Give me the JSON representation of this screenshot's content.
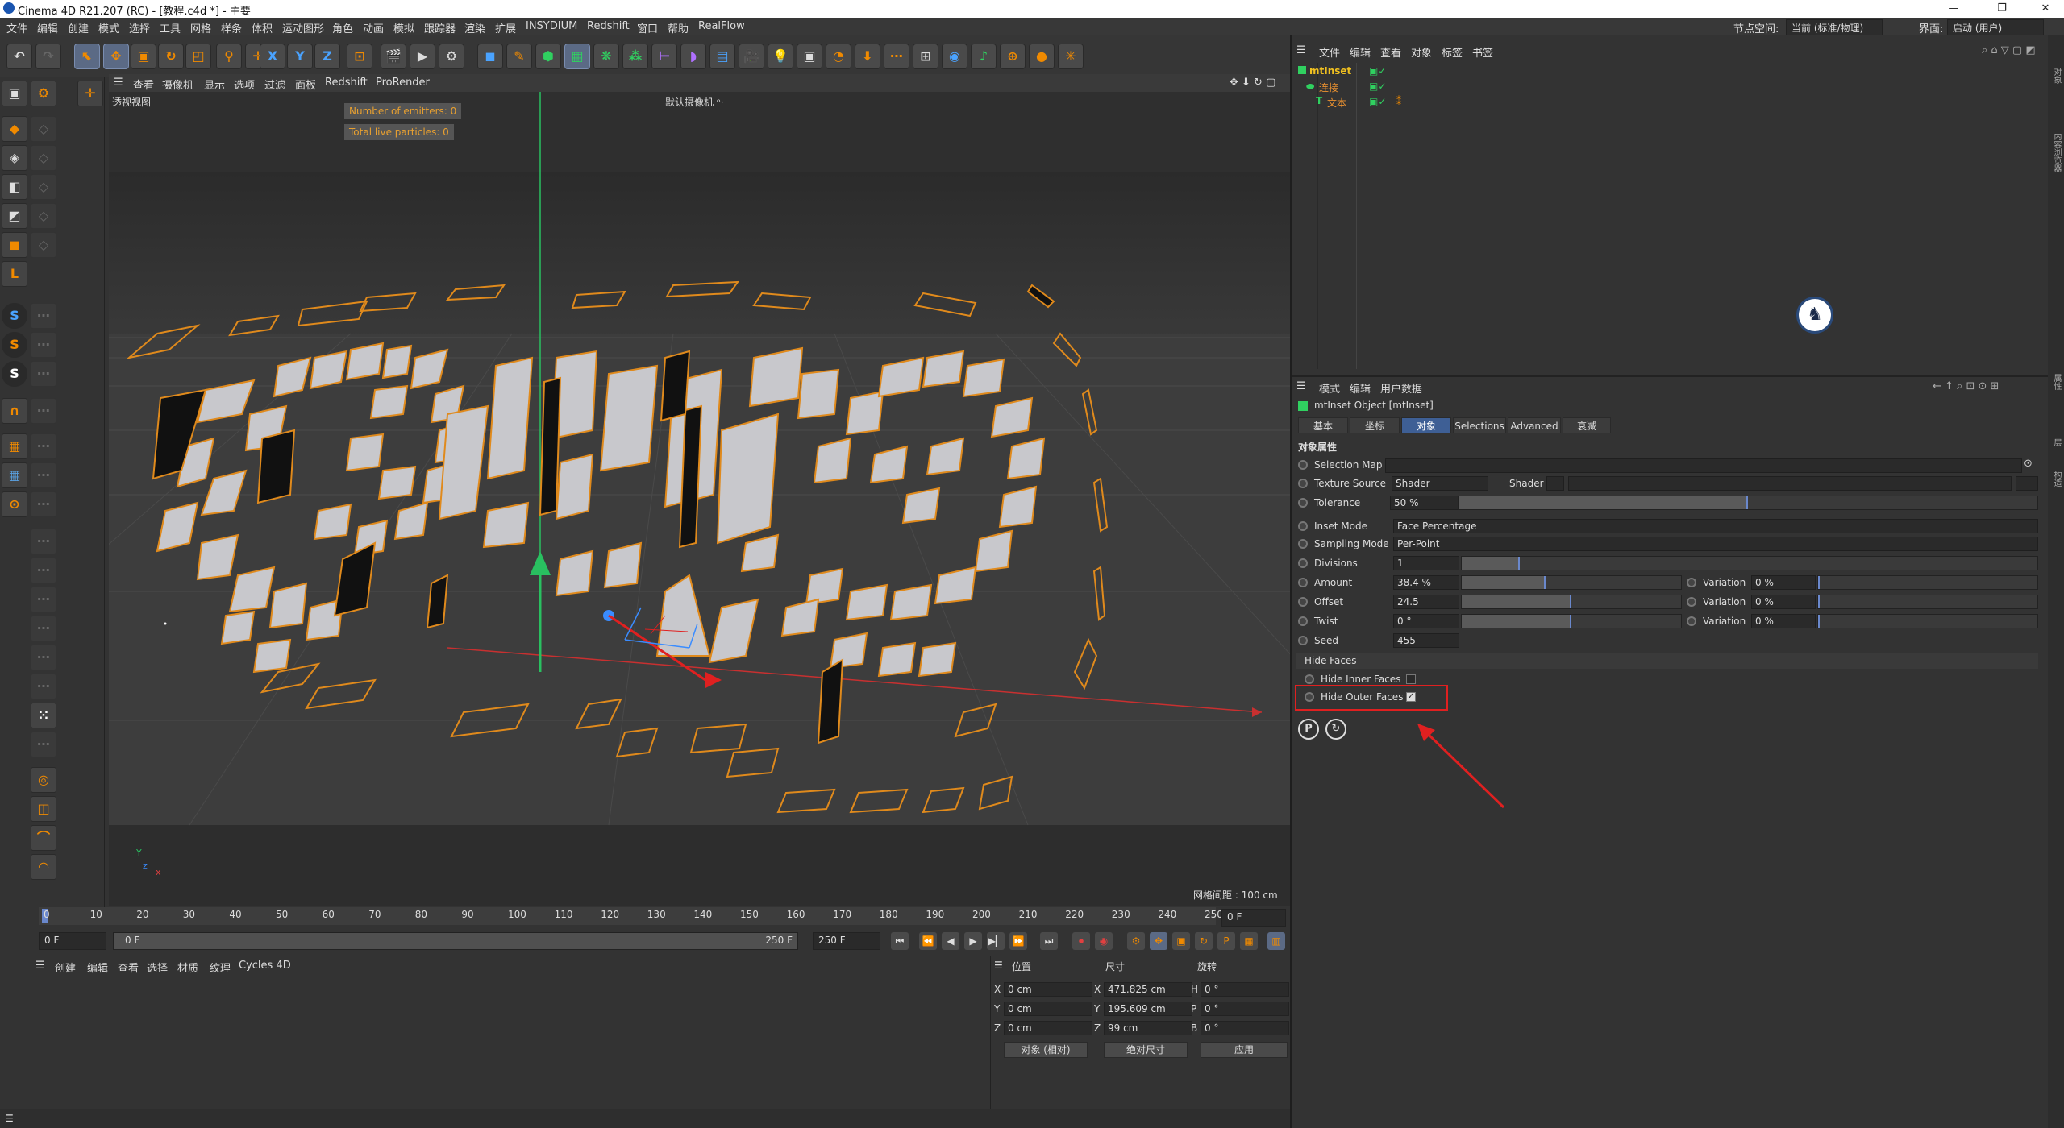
{
  "window": {
    "title": "Cinema 4D R21.207 (RC) - [教程.c4d *] - 主要",
    "controls": [
      "—",
      "❐",
      "✕"
    ]
  },
  "menubar": {
    "items": [
      "文件",
      "编辑",
      "创建",
      "模式",
      "选择",
      "工具",
      "网格",
      "样条",
      "体积",
      "运动图形",
      "角色",
      "动画",
      "模拟",
      "跟踪器",
      "渲染",
      "扩展",
      "INSYDIUM",
      "Redshift",
      "窗口",
      "帮助",
      "RealFlow"
    ],
    "node_space_label": "节点空间:",
    "node_space_value": "当前 (标准/物理)",
    "interface_label": "界面:",
    "interface_value": "启动 (用户)"
  },
  "toolbar": {
    "axis_x": "X",
    "axis_y": "Y",
    "axis_z": "Z"
  },
  "left_tools": {
    "s1": "S",
    "s2": "S",
    "s3": "S"
  },
  "viewport_menu": {
    "items": [
      "查看",
      "摄像机",
      "显示",
      "选项",
      "过滤",
      "面板",
      "Redshift",
      "ProRender"
    ]
  },
  "viewport": {
    "view_name": "透视视图",
    "camera_name": "默认摄像机 ᵒ·",
    "emitters": "Number of emitters: 0",
    "particles": "Total live particles: 0",
    "grid_spacing": "网格间距 : 100 cm",
    "axis_y": "Y",
    "axis_z": "z",
    "axis_x": "x"
  },
  "timeline": {
    "ticks": [
      "0",
      "10",
      "20",
      "30",
      "40",
      "50",
      "60",
      "70",
      "80",
      "90",
      "100",
      "110",
      "120",
      "130",
      "140",
      "150",
      "160",
      "170",
      "180",
      "190",
      "200",
      "210",
      "220",
      "230",
      "240",
      "250"
    ],
    "current_frame_end": "0 F",
    "start_field": "0 F",
    "range_start": "0 F",
    "range_end": "250 F",
    "end_field": "250 F"
  },
  "material_panel": {
    "items": [
      "创建",
      "编辑",
      "查看",
      "选择",
      "材质",
      "纹理",
      "Cycles 4D"
    ]
  },
  "coordinates": {
    "headers": [
      "位置",
      "尺寸",
      "旋转"
    ],
    "rows": [
      {
        "axis": "X",
        "pos": "0 cm",
        "size_axis": "X",
        "size": "471.825 cm",
        "rot_axis": "H",
        "rot": "0 °"
      },
      {
        "axis": "Y",
        "pos": "0 cm",
        "size_axis": "Y",
        "size": "195.609 cm",
        "rot_axis": "P",
        "rot": "0 °"
      },
      {
        "axis": "Z",
        "pos": "0 cm",
        "size_axis": "Z",
        "size": "99 cm",
        "rot_axis": "B",
        "rot": "0 °"
      }
    ],
    "mode_object": "对象 (相对)",
    "mode_size": "绝对尺寸",
    "apply": "应用"
  },
  "object_manager": {
    "menu": [
      "文件",
      "编辑",
      "查看",
      "对象",
      "标签",
      "书签"
    ],
    "objects": [
      {
        "name": "mtInset",
        "color": "#f0c020"
      },
      {
        "name": "连接",
        "color": "#e89030"
      },
      {
        "name": "文本",
        "color": "#e89030"
      }
    ]
  },
  "attribute_manager": {
    "menu": [
      "模式",
      "编辑",
      "用户数据"
    ],
    "object_title": "mtInset Object [mtInset]",
    "tabs": [
      "基本",
      "坐标",
      "对象",
      "Selections",
      "Advanced",
      "衰减"
    ],
    "active_tab": "对象",
    "section_title": "对象属性",
    "selection_map_label": "Selection Map",
    "texture_source_label": "Texture Source",
    "texture_source_value": "Shader",
    "shader_label": "Shader",
    "tolerance_label": "Tolerance",
    "tolerance_value": "50 %",
    "tolerance_fraction": 0.5,
    "inset_mode_label": "Inset Mode",
    "inset_mode_value": "Face Percentage",
    "sampling_mode_label": "Sampling Mode",
    "sampling_mode_value": "Per-Point",
    "divisions_label": "Divisions",
    "divisions_value": "1",
    "amount_label": "Amount",
    "amount_value": "38.4 %",
    "amount_fraction": 0.384,
    "offset_label": "Offset",
    "offset_value": "24.5",
    "offset_fraction": 0.5,
    "twist_label": "Twist",
    "twist_value": "0 °",
    "twist_fraction": 0.5,
    "seed_label": "Seed",
    "seed_value": "455",
    "variation_label": "Variation",
    "variation_value": "0 %",
    "hide_faces_section": "Hide Faces",
    "hide_inner_label": "Hide Inner Faces",
    "hide_outer_label": "Hide Outer Faces"
  },
  "colors": {
    "accent": "#3e5f95",
    "highlight_box": "#e02020",
    "polygon_edge": "#e08a1c",
    "polygon_fill": "#c8c8cc"
  }
}
